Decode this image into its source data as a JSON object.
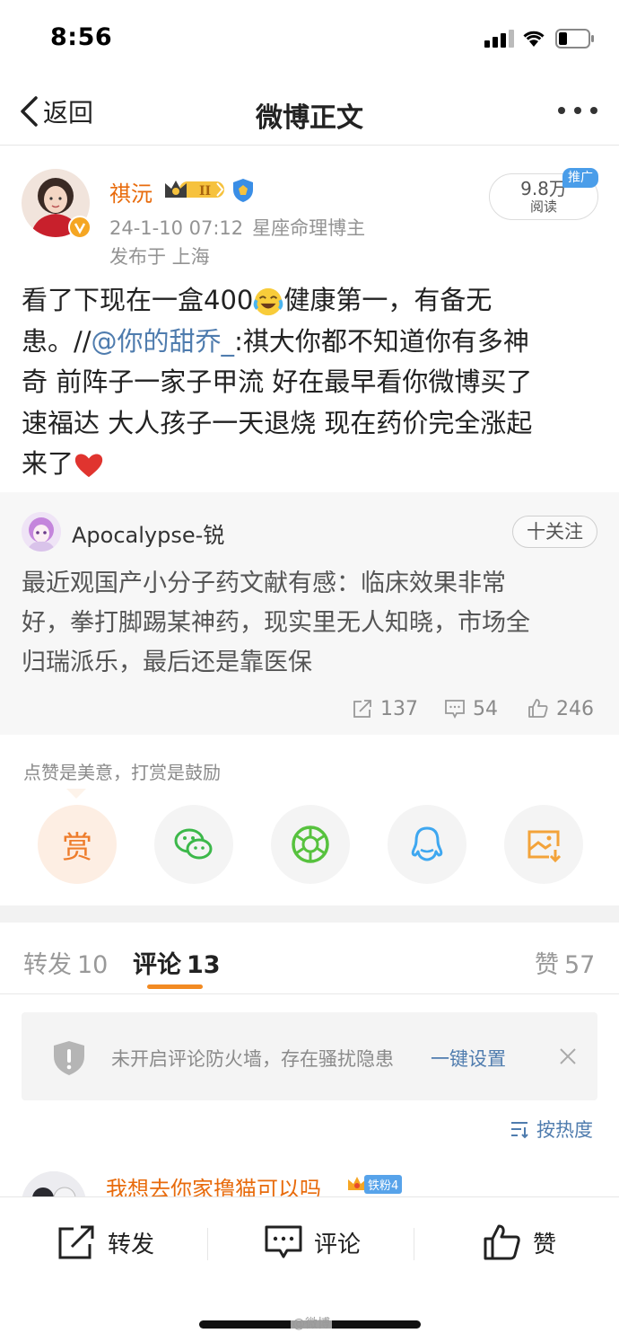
{
  "status_bar": {
    "time": "8:56"
  },
  "nav": {
    "back_label": "返回",
    "title": "微博正文"
  },
  "author": {
    "name": "祺沅",
    "date": "24-1-10 07:12",
    "bio": "星座命理博主",
    "location": "发布于 上海",
    "reads_count": "9.8万",
    "reads_label": "阅读",
    "promo_tag": "推广"
  },
  "post": {
    "line1_a": "看了下现在一盒400",
    "line1_b": "健康第一，有备无",
    "line2_a": "患。//",
    "mention": "@你的甜乔_",
    "line2_b": ":祺大你都不知道你有多神",
    "line3": "奇 前阵子一家子甲流 好在最早看你微博买了",
    "line4": "速福达 大人孩子一天退烧 现在药价完全涨起",
    "line5": "来了"
  },
  "repost": {
    "author": "Apocalypse-锐",
    "follow_label": "十关注",
    "text_line1": "最近观国产小分子药文献有感：临床效果非常",
    "text_line2": "好，拳打脚踢某神药，现实里无人知晓，市场全",
    "text_line3": "归瑞派乐，最后还是靠医保",
    "reposts": "137",
    "comments": "54",
    "likes": "246"
  },
  "reward": {
    "tip": "点赞是美意，打赏是鼓励",
    "reward_label": "赏"
  },
  "tabs": {
    "repost_label": "转发",
    "repost_count": "10",
    "comment_label": "评论",
    "comment_count": "13",
    "like_label": "赞",
    "like_count": "57"
  },
  "notice": {
    "text": "未开启评论防火墙，存在骚扰隐患",
    "link": "一键设置"
  },
  "sort_label": "按热度",
  "first_comment": {
    "name": "我想去你家撸猫可以吗",
    "fan_badge": "铁粉4"
  },
  "toolbar": {
    "repost": "转发",
    "comment": "评论",
    "like": "赞"
  },
  "watermark": "@微博",
  "colors": {
    "accent_orange": "#f28a22",
    "link_blue": "#4f7cae",
    "name_orange": "#e86b0c"
  }
}
